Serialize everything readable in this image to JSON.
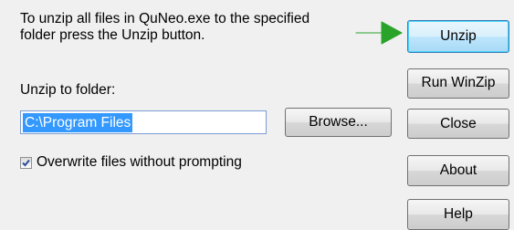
{
  "dialog": {
    "instructions": "To unzip all files in QuNeo.exe to the specified\nfolder press the Unzip button.",
    "folder_label": "Unzip to folder:",
    "folder_value": "C:\\Program Files",
    "overwrite_label": "Overwrite files without prompting",
    "overwrite_checked": true
  },
  "buttons": {
    "browse": "Browse...",
    "unzip": "Unzip",
    "run_winzip": "Run WinZip",
    "close": "Close",
    "about": "About",
    "help": "Help"
  },
  "colors": {
    "arrow": "#2aa32a",
    "selection": "#3399ff",
    "checkmark": "#2b4d9b"
  },
  "icons": {
    "arrow": "green-arrow-icon",
    "checkbox": "checkmark-icon"
  }
}
